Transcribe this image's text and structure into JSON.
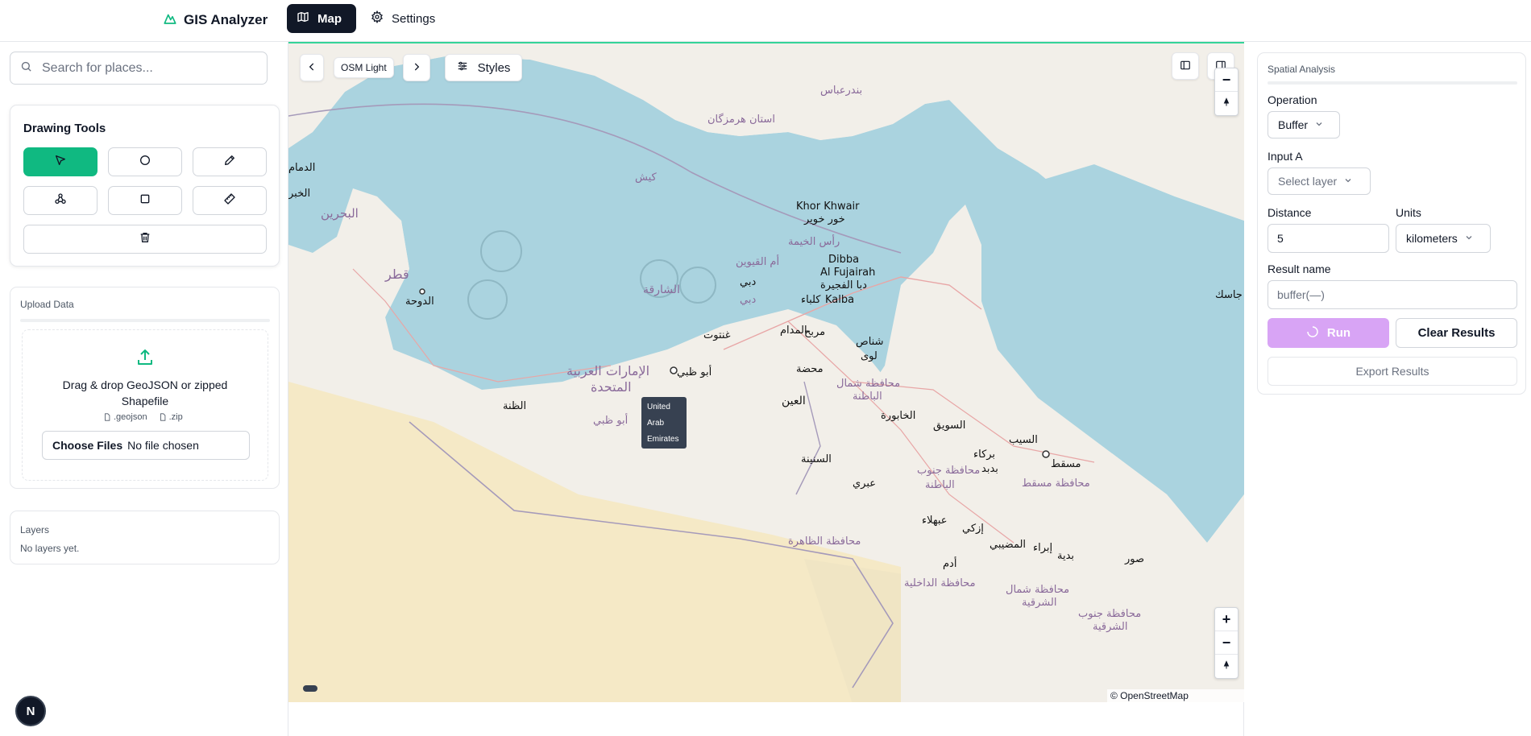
{
  "app": {
    "name": "GIS Analyzer",
    "brand_color": "#10b981"
  },
  "nav": {
    "map_label": "Map",
    "settings_label": "Settings"
  },
  "search": {
    "placeholder": "Search for places..."
  },
  "drawing_tools": {
    "title": "Drawing Tools",
    "tools": [
      {
        "icon": "cursor-icon",
        "active": true
      },
      {
        "icon": "circle-icon",
        "active": false
      },
      {
        "icon": "pencil-icon",
        "active": false
      },
      {
        "icon": "shapes-icon",
        "active": false
      },
      {
        "icon": "square-icon",
        "active": false
      },
      {
        "icon": "ruler-icon",
        "active": false
      },
      {
        "icon": "trash-icon",
        "active": false
      }
    ]
  },
  "upload": {
    "title": "Upload Data",
    "dropzone_text": "Drag & drop GeoJSON or zipped Shapefile",
    "ext_geojson": ".geojson",
    "ext_zip": ".zip",
    "choose_files": "Choose Files",
    "no_file": "No file chosen"
  },
  "layers": {
    "title": "Layers",
    "empty_text": "No layers yet."
  },
  "avatar": {
    "initial": "N"
  },
  "map": {
    "style_name": "OSM Light",
    "styles_label": "Styles",
    "tooltip_lines": [
      "United",
      "Arab",
      "Emirates"
    ],
    "attribution": "© OpenStreetMap contributors",
    "zoom_in": "+",
    "zoom_out": "−",
    "labels": [
      {
        "text": "بندرعباس"
      },
      {
        "text": "استان هرمزگان"
      },
      {
        "text": "کیش"
      },
      {
        "text": "Khor Khwair"
      },
      {
        "text": "خور خوير"
      },
      {
        "text": "رأس الخيمة"
      },
      {
        "text": "أم القيوين"
      },
      {
        "text": "Dibba"
      },
      {
        "text": "Al Fujairah"
      },
      {
        "text": "دبا الفجيرة"
      },
      {
        "text": "Kalba"
      },
      {
        "text": "كلباء"
      },
      {
        "text": "الشارقة"
      },
      {
        "text": "دبي"
      },
      {
        "text": "البحرين"
      },
      {
        "text": "قطر"
      },
      {
        "text": "الدوحة"
      },
      {
        "text": "الإمارات العربية"
      },
      {
        "text": "المتحدة"
      },
      {
        "text": "أبو ظبي"
      },
      {
        "text": "غنتوت"
      },
      {
        "text": "المدام"
      },
      {
        "text": "مربح"
      },
      {
        "text": "شناص"
      },
      {
        "text": "لوى"
      },
      {
        "text": "محضة"
      },
      {
        "text": "العين"
      },
      {
        "text": "محافظة شمال"
      },
      {
        "text": "الباطنة"
      },
      {
        "text": "الخابورة"
      },
      {
        "text": "السويق"
      },
      {
        "text": "السيب"
      },
      {
        "text": "مسقط"
      },
      {
        "text": "محافظة مسقط"
      },
      {
        "text": "بركاء"
      },
      {
        "text": "بدبد"
      },
      {
        "text": "محافظة جنوب"
      },
      {
        "text": "الباطنة"
      },
      {
        "text": "السنينة"
      },
      {
        "text": "عبري"
      },
      {
        "text": "عبهلاء"
      },
      {
        "text": "إزكي"
      },
      {
        "text": "المضيبي"
      },
      {
        "text": "إبراء"
      },
      {
        "text": "بدية"
      },
      {
        "text": "صور"
      },
      {
        "text": "أدم"
      },
      {
        "text": "محافظة الظاهرة"
      },
      {
        "text": "محافظة الداخلية"
      },
      {
        "text": "محافظة شمال"
      },
      {
        "text": "الشرقية"
      },
      {
        "text": "محافظة جنوب"
      },
      {
        "text": "الشرقية"
      },
      {
        "text": "جاسك"
      },
      {
        "text": "الظنة"
      },
      {
        "text": "أبو ظبي"
      },
      {
        "text": "الدمام"
      },
      {
        "text": "الخبر"
      },
      {
        "text": "دبي"
      }
    ],
    "water_color": "#aad3df",
    "land_color": "#f2efe9",
    "desert_color": "#f5e9c6"
  },
  "analysis": {
    "title": "Spatial Analysis",
    "operation_label": "Operation",
    "operation_value": "Buffer",
    "input_a_label": "Input A",
    "input_a_placeholder": "Select layer",
    "distance_label": "Distance",
    "distance_value": "5",
    "units_label": "Units",
    "units_value": "kilometers",
    "result_name_label": "Result name",
    "result_name_placeholder": "buffer(—)",
    "run_label": "Run",
    "clear_label": "Clear Results",
    "export_label": "Export Results"
  }
}
